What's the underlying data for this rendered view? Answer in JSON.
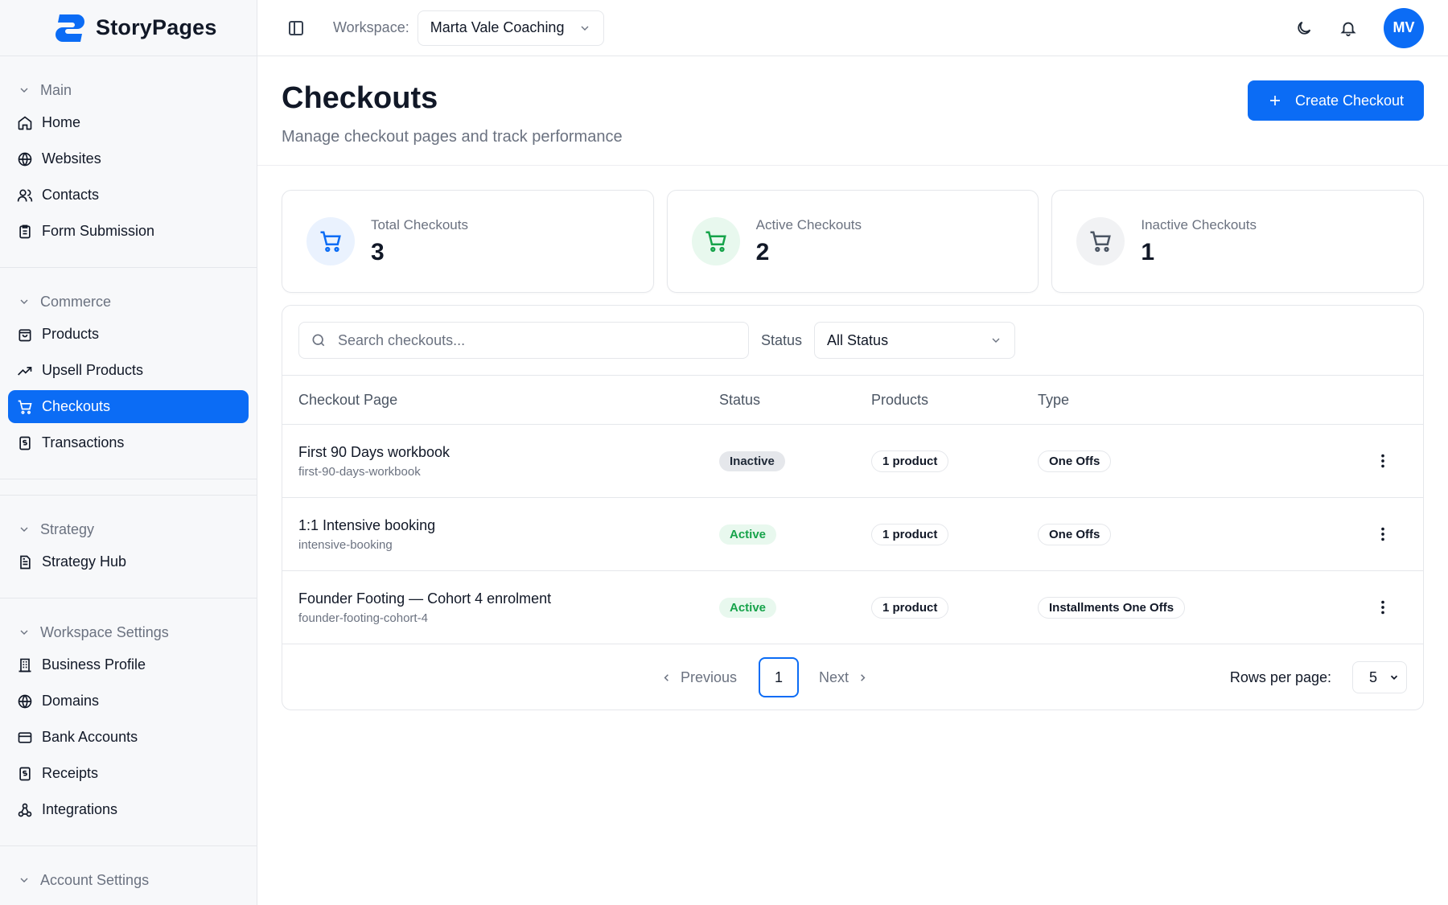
{
  "brand": {
    "name": "StoryPages"
  },
  "header": {
    "workspace_label": "Workspace:",
    "workspace_value": "Marta Vale Coaching",
    "avatar_initials": "MV"
  },
  "sidebar": {
    "sections": [
      {
        "title": "Main",
        "items": [
          {
            "label": "Home",
            "icon": "home-icon"
          },
          {
            "label": "Websites",
            "icon": "globe-icon"
          },
          {
            "label": "Contacts",
            "icon": "users-icon"
          },
          {
            "label": "Form Submission",
            "icon": "clipboard-icon"
          }
        ]
      },
      {
        "title": "Commerce",
        "items": [
          {
            "label": "Products",
            "icon": "shopping-bag-icon"
          },
          {
            "label": "Upsell Products",
            "icon": "trending-up-icon"
          },
          {
            "label": "Checkouts",
            "icon": "cart-icon",
            "active": true
          },
          {
            "label": "Transactions",
            "icon": "receipt-icon"
          }
        ]
      },
      {
        "title": "Strategy",
        "items": [
          {
            "label": "Strategy Hub",
            "icon": "document-icon"
          }
        ]
      },
      {
        "title": "Workspace Settings",
        "items": [
          {
            "label": "Business Profile",
            "icon": "building-icon"
          },
          {
            "label": "Domains",
            "icon": "globe-icon"
          },
          {
            "label": "Bank Accounts",
            "icon": "credit-card-icon"
          },
          {
            "label": "Receipts",
            "icon": "receipt-icon"
          },
          {
            "label": "Integrations",
            "icon": "webhook-icon"
          }
        ]
      },
      {
        "title": "Account Settings",
        "items": []
      }
    ]
  },
  "page": {
    "title": "Checkouts",
    "subtitle": "Manage checkout pages and track performance",
    "create_label": "Create Checkout"
  },
  "stats": {
    "total": {
      "label": "Total Checkouts",
      "value": "3"
    },
    "active": {
      "label": "Active Checkouts",
      "value": "2"
    },
    "inactive": {
      "label": "Inactive Checkouts",
      "value": "1"
    }
  },
  "filters": {
    "search_placeholder": "Search checkouts...",
    "status_label": "Status",
    "status_value": "All Status"
  },
  "table": {
    "columns": [
      "Checkout Page",
      "Status",
      "Products",
      "Type"
    ],
    "rows": [
      {
        "title": "First 90 Days workbook",
        "slug": "first-90-days-workbook",
        "status": "Inactive",
        "products": "1 product",
        "type": "One Offs"
      },
      {
        "title": "1:1 Intensive booking",
        "slug": "intensive-booking",
        "status": "Active",
        "products": "1 product",
        "type": "One Offs"
      },
      {
        "title": "Founder Footing — Cohort 4 enrolment",
        "slug": "founder-footing-cohort-4",
        "status": "Active",
        "products": "1 product",
        "type": "Installments One Offs"
      }
    ]
  },
  "pagination": {
    "previous": "Previous",
    "page": "1",
    "next": "Next",
    "rows_label": "Rows per page:",
    "rows_value": "5"
  },
  "colors": {
    "accent": "#0b6cf5",
    "active_green": "#16a34a",
    "active_bg": "#e8f8ee",
    "inactive_bg": "#e5e7eb"
  }
}
